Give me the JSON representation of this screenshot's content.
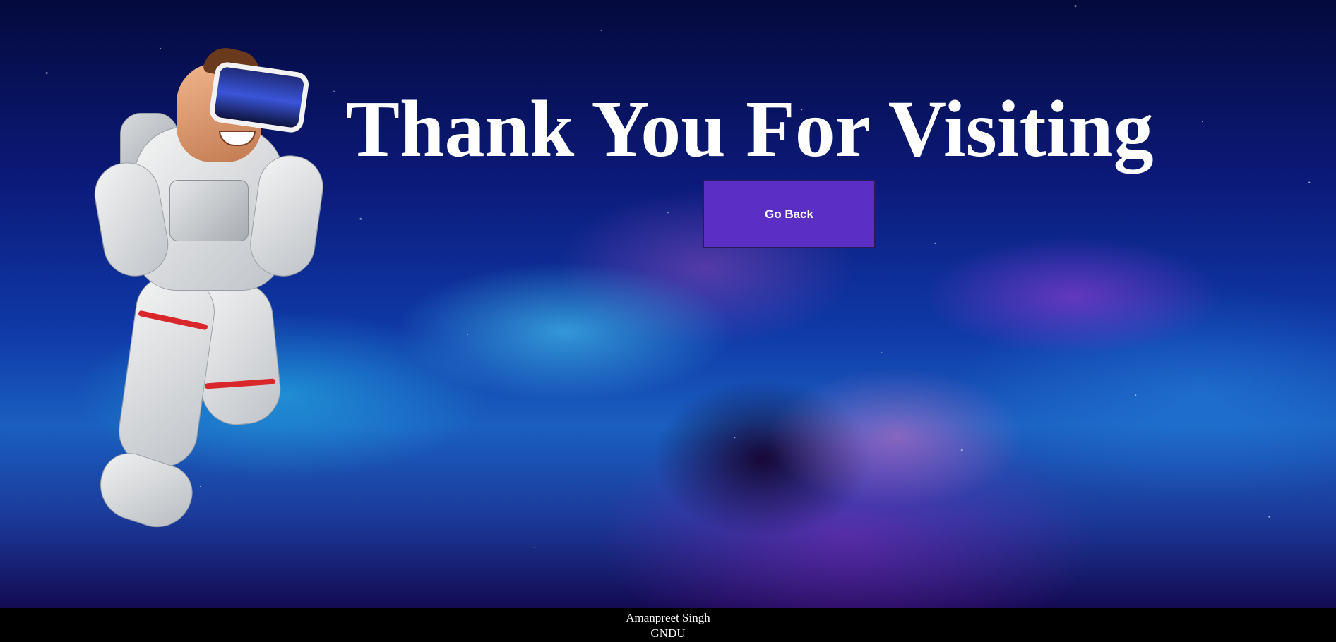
{
  "main": {
    "heading": "Thank You For Visiting",
    "go_back_label": "Go Back"
  },
  "footer": {
    "name": "Amanpreet Singh",
    "institution": "GNDU"
  },
  "colors": {
    "button_bg": "#5b2fc4",
    "footer_bg": "#000000",
    "text": "#ffffff"
  },
  "icons": {
    "hero_illustration": "astronaut-vr-illustration"
  }
}
